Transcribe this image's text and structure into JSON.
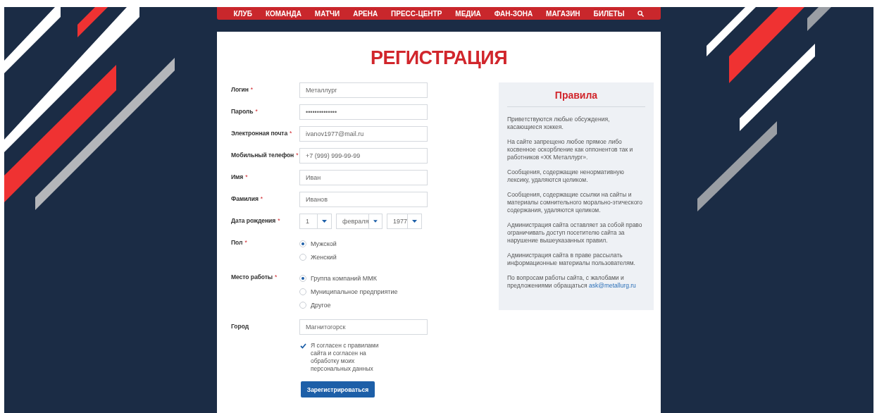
{
  "nav": {
    "items": [
      "КЛУБ",
      "КОМАНДА",
      "МАТЧИ",
      "АРЕНА",
      "ПРЕСС-ЦЕНТР",
      "МЕДИА",
      "ФАН-ЗОНА",
      "МАГАЗИН",
      "БИЛЕТЫ"
    ]
  },
  "title": "РЕГИСТРАЦИЯ",
  "form": {
    "fields": [
      {
        "kind": "text",
        "label": "Логин",
        "required_mark": "*",
        "value": "Металлург"
      },
      {
        "kind": "text",
        "label": "Пароль",
        "required_mark": "*",
        "value": "••••••••••••••"
      },
      {
        "kind": "text",
        "label": "Электронная почта",
        "required_mark": "*",
        "value": "ivanov1977@mail.ru"
      },
      {
        "kind": "text",
        "label": "Мобильный телефон",
        "required_mark": "*",
        "value": "+7 (999) 999-99-99"
      },
      {
        "kind": "text",
        "label": "Имя",
        "required_mark": "*",
        "value": "Иван"
      },
      {
        "kind": "text",
        "label": "Фамилия",
        "required_mark": "*",
        "value": "Иванов"
      },
      {
        "kind": "date",
        "label": "Дата рождения",
        "required_mark": "*",
        "selects": [
          "1",
          "февраля",
          "1977"
        ]
      },
      {
        "kind": "radio",
        "label": "Пол",
        "required_mark": "*",
        "options": [
          {
            "label": "Мужской",
            "selected": true
          },
          {
            "label": "Женский",
            "selected": false
          }
        ]
      },
      {
        "kind": "radio",
        "label": "Место работы",
        "required_mark": "*",
        "options": [
          {
            "label": "Группа компаний ММК",
            "selected": true
          },
          {
            "label": "Муниципальное предприятие",
            "selected": false
          },
          {
            "label": "Другое",
            "selected": false
          }
        ]
      },
      {
        "kind": "text",
        "label": "Город",
        "value": "Магнитогорск"
      }
    ],
    "agreement": {
      "label": "Я согласен с правилами сайта и согласен на обработку моих персональных данных",
      "checked": true
    },
    "submit": "Зарегистрироваться"
  },
  "rules": {
    "title": "Правила",
    "paragraphs": [
      "Приветствуются любые обсуждения, касающиеся хоккея.",
      "На сайте запрещено любое прямое либо косвенное оскорбление как оппонентов так и работников «ХК Металлург».",
      "Сообщения, содержащие ненормативную лексику, удаляются целиком.",
      "Сообщения, содержащие ссылки на сайты и материалы сомнительного морально-этического содержания, удаляются целиком.",
      "Администрация сайта оставляет за собой право ограничивать доступ посетителю сайта за нарушение вышеуказанных правил.",
      "Администрация сайта в праве рассылать информационные материалы пользователям."
    ],
    "contact": {
      "text": "По вопросам работы сайта, с жалобами и предложениями обращаться",
      "link": "ask@metallurg.ru"
    }
  }
}
